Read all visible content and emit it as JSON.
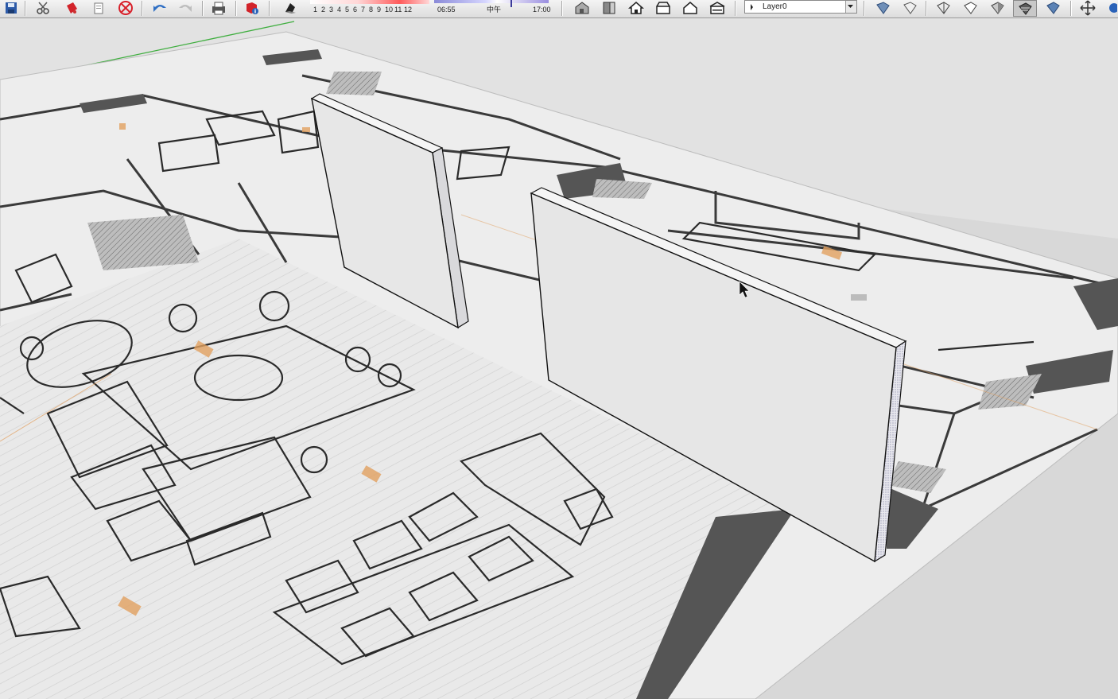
{
  "toolbar": {
    "month_scale": [
      "1",
      "2",
      "3",
      "4",
      "5",
      "6",
      "7",
      "8",
      "9",
      "10",
      "11",
      "12"
    ],
    "time_start": "06:55",
    "time_mid": "中午",
    "time_end": "17:00",
    "layer_value": "Layer0"
  },
  "icons": [
    "save-icon",
    "cut-icon",
    "paint-icon",
    "copy-icon",
    "erase-icon",
    "undo-icon",
    "redo-icon",
    "print-icon",
    "model-info-icon",
    "shadow-icon",
    "house-iso-icon",
    "house-top-icon",
    "house-front-icon",
    "house-right-icon",
    "house-back-icon",
    "house-left-icon",
    "layer-icon",
    "style-icons",
    "move-icon"
  ],
  "colors": {
    "wall_face": "#e6e6e6",
    "wall_top": "#f4f4f4",
    "plan_paper": "#ececec",
    "ground": "#d6d6d6",
    "green_axis": "#3fae3f"
  }
}
